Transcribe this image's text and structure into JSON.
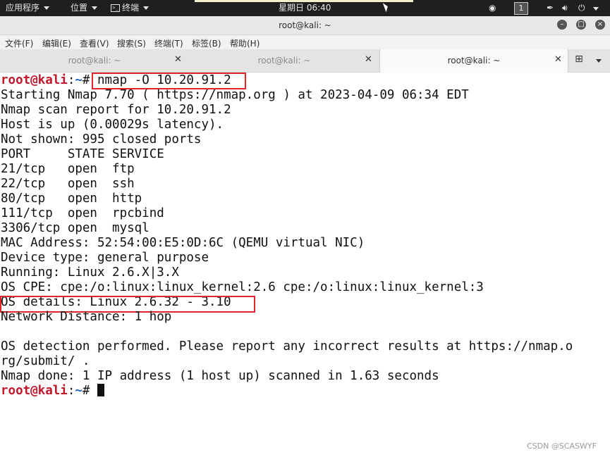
{
  "top_panel": {
    "apps_label": "应用程序",
    "places_label": "位置",
    "terminal_label": "终端",
    "clock": "星期日 06:40",
    "workspace": "1",
    "tray_icons": [
      "camera-icon",
      "pen-icon",
      "volume-icon",
      "power-icon"
    ]
  },
  "window": {
    "title": "root@kali: ~",
    "menu": [
      "文件(F)",
      "编辑(E)",
      "查看(V)",
      "搜索(S)",
      "终端(T)",
      "标签(B)",
      "帮助(H)"
    ],
    "tabs": [
      {
        "label": "root@kali: ~"
      },
      {
        "label": "root@kali: ~"
      },
      {
        "label": "root@kali: ~"
      }
    ],
    "active_tab_index": 2
  },
  "terminal": {
    "prompt_user": "root@kali",
    "prompt_sep": ":",
    "prompt_path": "~",
    "prompt_symbol": "#",
    "command": " nmap -O 10.20.91.2",
    "output": [
      "Starting Nmap 7.70 ( https://nmap.org ) at 2023-04-09 06:34 EDT",
      "Nmap scan report for 10.20.91.2",
      "Host is up (0.00029s latency).",
      "Not shown: 995 closed ports",
      "PORT     STATE SERVICE",
      "21/tcp   open  ftp",
      "22/tcp   open  ssh",
      "80/tcp   open  http",
      "111/tcp  open  rpcbind",
      "3306/tcp open  mysql",
      "MAC Address: 52:54:00:E5:0D:6C (QEMU virtual NIC)",
      "Device type: general purpose",
      "Running: Linux 2.6.X|3.X",
      "OS CPE: cpe:/o:linux:linux_kernel:2.6 cpe:/o:linux:linux_kernel:3",
      "OS details: Linux 2.6.32 - 3.10",
      "Network Distance: 1 hop",
      "",
      "OS detection performed. Please report any incorrect results at https://nmap.o",
      "rg/submit/ .",
      "Nmap done: 1 IP address (1 host up) scanned in 1.63 seconds"
    ]
  },
  "watermark": "CSDN @SCASWYF",
  "colors": {
    "prompt_user": "#c0192c",
    "prompt_path": "#2563c9",
    "highlight_box": "#e0242c"
  }
}
